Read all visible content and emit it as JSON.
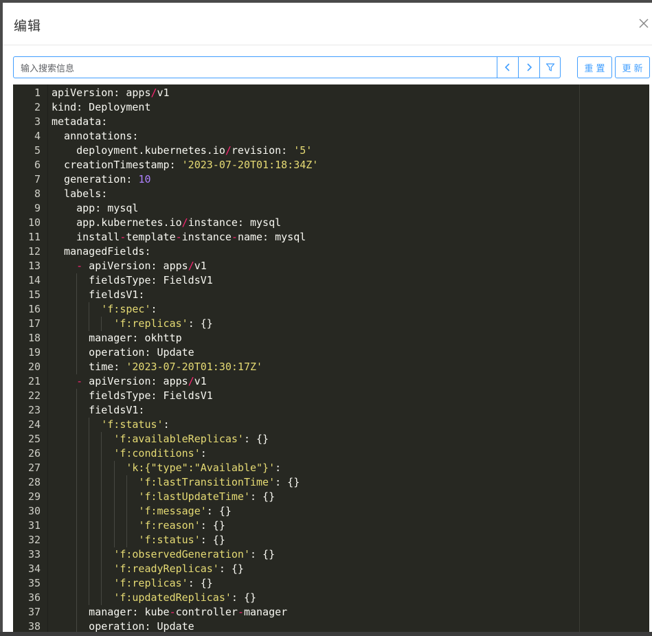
{
  "dialog": {
    "title": "编辑"
  },
  "search": {
    "placeholder": "输入搜索信息",
    "value": ""
  },
  "buttons": {
    "reset_label": "重置",
    "update_label": "更新"
  },
  "icons": {
    "prev": "chevron-left-icon",
    "next": "chevron-right-icon",
    "filter": "filter-icon",
    "close": "close-icon"
  },
  "colors": {
    "accent": "#409eff",
    "editor_bg": "#272822",
    "string": "#e6db74",
    "number": "#ae81ff",
    "operator": "#f92672"
  },
  "editor": {
    "lines": [
      "apiVersion: apps/v1",
      "kind: Deployment",
      "metadata:",
      "  annotations:",
      "    deployment.kubernetes.io/revision: '5'",
      "  creationTimestamp: '2023-07-20T01:18:34Z'",
      "  generation: 10",
      "  labels:",
      "    app: mysql",
      "    app.kubernetes.io/instance: mysql",
      "    install-template-instance-name: mysql",
      "  managedFields:",
      "    - apiVersion: apps/v1",
      "      fieldsType: FieldsV1",
      "      fieldsV1:",
      "        'f:spec':",
      "          'f:replicas': {}",
      "      manager: okhttp",
      "      operation: Update",
      "      time: '2023-07-20T01:30:17Z'",
      "    - apiVersion: apps/v1",
      "      fieldsType: FieldsV1",
      "      fieldsV1:",
      "        'f:status':",
      "          'f:availableReplicas': {}",
      "          'f:conditions':",
      "            'k:{\"type\":\"Available\"}':",
      "              'f:lastTransitionTime': {}",
      "              'f:lastUpdateTime': {}",
      "              'f:message': {}",
      "              'f:reason': {}",
      "              'f:status': {}",
      "          'f:observedGeneration': {}",
      "          'f:readyReplicas': {}",
      "          'f:replicas': {}",
      "          'f:updatedReplicas': {}",
      "      manager: kube-controller-manager",
      "      operation: Update"
    ]
  }
}
